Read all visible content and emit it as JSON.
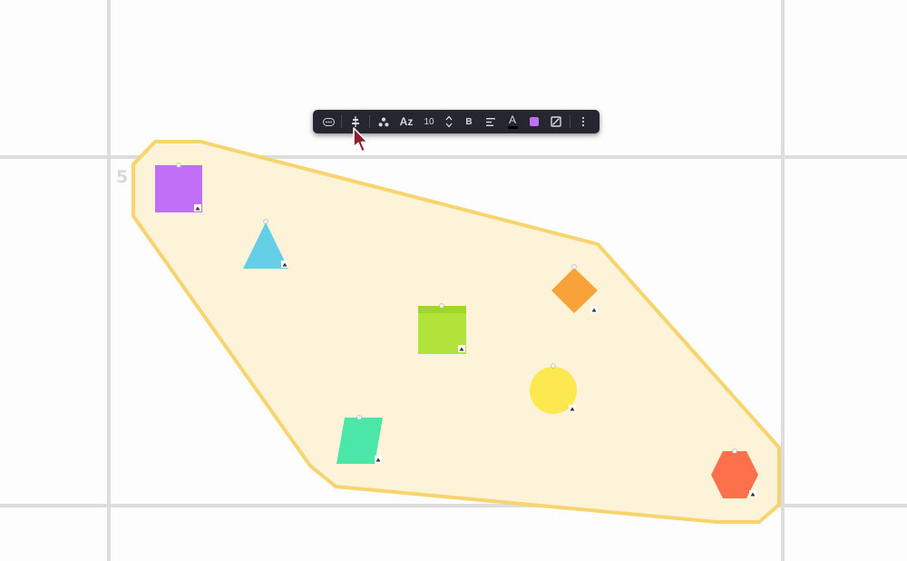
{
  "frame": {
    "number": "5"
  },
  "toolbar": {
    "font_label": "Az",
    "size_value": "10",
    "bold_label": "B",
    "text_color_label": "A",
    "fill_color": "#c26ff7"
  },
  "colors": {
    "selection_fill": "#fdf3d9",
    "selection_stroke": "#f7d46e",
    "square": "#c26ff7",
    "triangle": "#65cfe8",
    "note": "#b1e33b",
    "diamond": "#f9a23a",
    "circle": "#fce94f",
    "parallelogram": "#4ae7a8",
    "hexagon": "#fd704c",
    "cursor": "#8b1f30"
  }
}
